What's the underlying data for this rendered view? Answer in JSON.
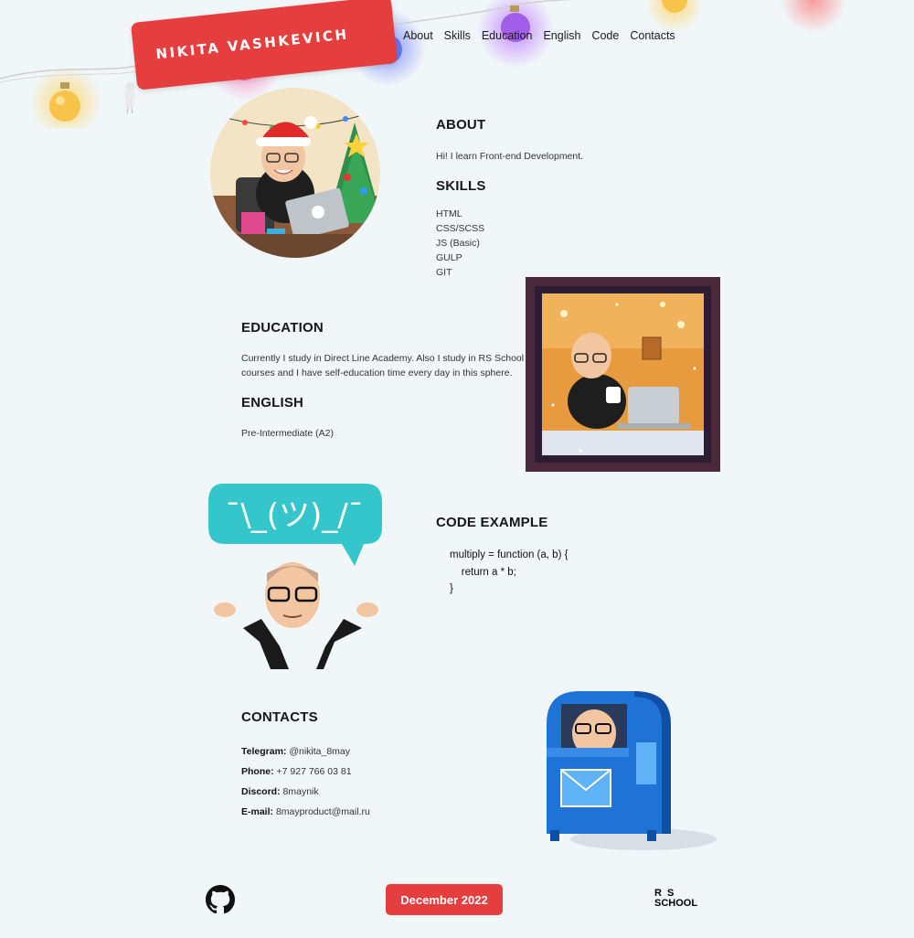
{
  "header": {
    "name": "NIKITA VASHKEVICH",
    "nav": [
      "About",
      "Skills",
      "Education",
      "English",
      "Code",
      "Contacts"
    ]
  },
  "about": {
    "title": "ABOUT",
    "text": "Hi! I learn Front-end Development."
  },
  "skills": {
    "title": "SKILLS",
    "items": [
      "HTML",
      "CSS/SCSS",
      "JS (Basic)",
      "GULP",
      "GIT"
    ]
  },
  "education": {
    "title": "EDUCATION",
    "line1": "Currently I study in Direct Line Academy. Also I study in RS School",
    "line2": "courses and I have self-education time every day in this sphere."
  },
  "english": {
    "title": "ENGLISH",
    "text": "Pre-Intermediate (A2)"
  },
  "shrug": {
    "text": "¯\\_(ツ)_/¯"
  },
  "code": {
    "title": "CODE EXAMPLE",
    "lines": [
      "multiply = function (a, b) {",
      "    return a * b;",
      "}"
    ]
  },
  "contacts": {
    "title": "CONTACTS",
    "items": [
      {
        "label": "Telegram:",
        "value": "@nikita_8may"
      },
      {
        "label": "Phone:",
        "value": "+7 927 766 03 81"
      },
      {
        "label": "Discord:",
        "value": "8maynik"
      },
      {
        "label": "E-mail:",
        "value": "8mayproduct@mail.ru"
      }
    ]
  },
  "footer": {
    "date": "December 2022",
    "rs_logo_line1": "R  S",
    "rs_logo_line2": "SCHOOL",
    "github_icon": "github-icon"
  },
  "colors": {
    "accent": "#e53e3f",
    "background": "#f1f6f9",
    "bubble": "#35c6cc",
    "mailbox": "#1f73d6"
  }
}
